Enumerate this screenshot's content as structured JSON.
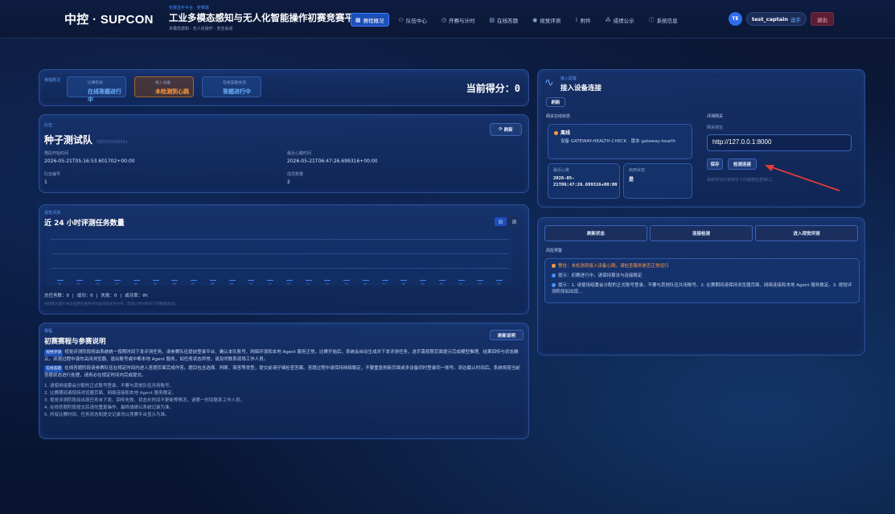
{
  "header": {
    "brand": "中控 · SUPCON",
    "kicker": "初赛选手平台 · 参赛端",
    "title": "工业多模态感知与无人化智能操作初赛竞赛平台",
    "subtitle": "多模态感知 · 无人化操作 · 安全会话",
    "nav": [
      {
        "label": "赛程概况",
        "icon": "grid-icon",
        "glyph": "▦",
        "active": true
      },
      {
        "label": "队伍中心",
        "icon": "users-icon",
        "glyph": "⚇",
        "active": false
      },
      {
        "label": "开赛与计时",
        "icon": "clock-icon",
        "glyph": "◷",
        "active": false
      },
      {
        "label": "在线答题",
        "icon": "document-icon",
        "glyph": "▤",
        "active": false
      },
      {
        "label": "视觉评测",
        "icon": "eye-icon",
        "glyph": "◉",
        "active": false
      },
      {
        "label": "附件",
        "icon": "paperclip-icon",
        "glyph": "⌇",
        "active": false
      },
      {
        "label": "成绩公示",
        "icon": "ranking-icon",
        "glyph": "⁂",
        "active": false
      },
      {
        "label": "系统信息",
        "icon": "info-icon",
        "glyph": "ⓘ",
        "active": false
      }
    ],
    "user": {
      "initials": "TE",
      "name": "test_captain",
      "role": "选手"
    },
    "logout": "退出"
  },
  "status": {
    "kicker": "赛程概况",
    "boxes": [
      {
        "label": "比赛阶段",
        "value": "在线答题进行中",
        "warn": false
      },
      {
        "label": "接入设备",
        "value": "未检测到心跳",
        "warn": true
      },
      {
        "label": "在线答题会话",
        "value": "答题进行中",
        "warn": false
      }
    ],
    "score": "当前得分：0"
  },
  "team": {
    "kicker": "队伍",
    "name": "种子测试队",
    "code": "SEED20260001",
    "refresh": "刷新",
    "fields": [
      {
        "label": "階段开始时间",
        "value": "2026-05-21T05:16:53.601702+00:00"
      },
      {
        "label": "最近心跳时间",
        "value": "2026-05-21T06:47:26.699316+00:00"
      },
      {
        "label": "队伍编号",
        "value": "1"
      },
      {
        "label": "成员数量",
        "value": "2"
      }
    ]
  },
  "chart_section": {
    "kicker": "视觉评测",
    "title": "近 24 小时评测任务数量",
    "toggle": [
      "日",
      "周"
    ],
    "summary": "总任务数：0 | 成功：0 | 失败：0 | 成功率：0%",
    "note": "柱状图为基于本队伍所在服务时间段内的任务分布（无缺少时间时间下的数据状态）"
  },
  "chart_data": {
    "type": "bar",
    "categories": [
      "00",
      "01",
      "02",
      "03",
      "04",
      "05",
      "06",
      "07",
      "08",
      "09",
      "10",
      "11",
      "12",
      "13",
      "14",
      "15",
      "16",
      "17",
      "18",
      "19",
      "20",
      "21",
      "22",
      "23"
    ],
    "values": [
      0,
      0,
      0,
      0,
      0,
      0,
      0,
      0,
      0,
      0,
      0,
      0,
      0,
      0,
      0,
      0,
      0,
      0,
      0,
      0,
      0,
      0,
      0,
      0
    ],
    "ylim": [
      0,
      1
    ],
    "grid": true,
    "legend": "none"
  },
  "rules": {
    "kicker": "赛程",
    "title": "初赛赛程与参赛说明",
    "refresh": "刷新说明",
    "p1_tag": "视觉评测",
    "p1": "视觉评测阶段将由系统统一按照时间下发评测任务。请参赛队伍提前登录平台、确认本队账号、网络环境和本地 Agent 服务正常。比赛开始后，系统会自动生成并下发评测任务，选手需按照页面提示完成模型推理、结果回传与状态确认。评测过程中请勿关闭浏览器、退出账号或中断本地 Agent 服务，如任务状态异常，请及时联系现场工作人员。",
    "p2_tag": "在线答题",
    "p2": "在线答题阶段请参赛队伍在规定时间内进入答题页面完成作答。题目包含选择、判断、简答等类型，提交前请仔细检查答案。答题过程中请保持网络稳定，不要重复刷新页面或多设备同时登录同一账号。到达截止时间后，系统将按当前答题状态进行处理，请务必在规定时间内完成提交。",
    "items": [
      "1. 请使用组委会分配的正式账号登录，不要与其他队伍共用账号。",
      "2. 比赛期间请保持浏览器页面、网络连接和本地 Agent 服务稳定。",
      "3. 视觉评测阶段如出现任务未下发、回传失败、状态长时间不更新等情况，请第一时间联系工作人员。",
      "4. 在线答题阶段提交后请勿重复操作，最终成绩以系统记录为准。",
      "5. 所有比赛时间、任务状态和提交记录均以竞赛平台显示为准。"
    ]
  },
  "device": {
    "kicker": "接入配置",
    "title": "接入设备连接",
    "refresh": "刷新",
    "gateway_status_label": "网关在线状态",
    "online": "离线",
    "device_text": "设备 GATEWAY-HEALTH-CHECK · 版本 gateway-health",
    "heartbeat_label": "最近心跳",
    "heartbeat_value": "2026-05-21T06:47:26.699316+00:00",
    "enabled_label": "启用状态",
    "enabled_value": "是",
    "eval_label": "评测网关",
    "address_label": "网关地址",
    "address": "http://127.0.0.1:8000",
    "save": "保存",
    "check": "检测连接",
    "hint": "系统将访问该地址下的健康检查接口。"
  },
  "actions": {
    "buttons": [
      "刷新状态",
      "连接检测",
      "进入视觉评测"
    ],
    "alerts_title": "风险预警",
    "alerts": [
      {
        "text": "警告：未检测到接入设备心跳，请检查服务是否正常运行",
        "color": "#ff9a3e",
        "text_color": "#ff9a3e"
      },
      {
        "text": "提示：初赛进行中，请保持算法与连接稳定",
        "color": "#4b8dff",
        "text_color": "#c7d6f5"
      },
      {
        "text": "提示：1. 请使用组委会分配的正式账号登录，不要与其他队伍共用账号。2. 比赛期间请保持浏览器页面、网络连接和本地 Agent 服务稳定。3. 视觉评测阶段如出现...",
        "color": "#4b8dff",
        "text_color": "#c7d6f5"
      }
    ]
  }
}
